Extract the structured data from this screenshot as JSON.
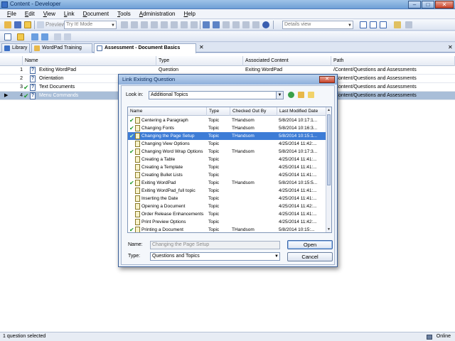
{
  "window": {
    "title": "Content - Developer",
    "min": "–",
    "max": "□",
    "close": "✕"
  },
  "menu": [
    "File",
    "Edit",
    "View",
    "Link",
    "Document",
    "Tools",
    "Administration",
    "Help"
  ],
  "toolbar": {
    "preview_label": "Preview",
    "mode_combo": "Try It! Mode",
    "view_combo": "Details view"
  },
  "tabs": [
    {
      "label": "Library"
    },
    {
      "label": "WordPad Training"
    },
    {
      "label": "Assessment - Document Basics",
      "active": true
    }
  ],
  "tab_close": "✕",
  "grid": {
    "columns": [
      "Name",
      "Type",
      "Associated Content",
      "Path"
    ],
    "rows": [
      {
        "num": "1",
        "check": "",
        "name": "Exiting WordPad",
        "type": "Question",
        "associated": "Exiting WordPad",
        "path": "/Content/Questions and Assessments"
      },
      {
        "num": "2",
        "check": "",
        "name": "Orientation",
        "type": "",
        "associated": "",
        "path": "/Content/Questions and Assessments"
      },
      {
        "num": "3",
        "check": "✔",
        "name": "Text Documents",
        "type": "",
        "associated": "",
        "path": "/Content/Questions and Assessments"
      },
      {
        "num": "4",
        "check": "✔",
        "name": "Menu Commands",
        "type": "",
        "associated": "",
        "path": "/Content/Questions and Assessments",
        "selected": true,
        "marker": "▶"
      }
    ]
  },
  "dialog": {
    "title": "Link Existing Question",
    "close": "✕",
    "look_in_label": "Look in:",
    "look_in_value": "Additional Topics",
    "columns": [
      "Name",
      "Type",
      "Checked Out By",
      "Last Modified Date"
    ],
    "items": [
      {
        "check": "✔",
        "name": "Centering a Paragraph",
        "type": "Topic",
        "checked_out": "THandsom",
        "date": "5/8/2014 10:17:1..."
      },
      {
        "check": "✔",
        "name": "Changing Fonts",
        "type": "Topic",
        "checked_out": "THandsom",
        "date": "5/8/2014 10:16:3..."
      },
      {
        "check": "✔",
        "name": "Changing the Page Setup",
        "type": "Topic",
        "checked_out": "THandsom",
        "date": "5/8/2014 10:15:1...",
        "selected": true
      },
      {
        "check": "",
        "name": "Changing View Options",
        "type": "Topic",
        "checked_out": "",
        "date": "4/25/2014 11:42:..."
      },
      {
        "check": "✔",
        "name": "Changing Word Wrap Options",
        "type": "Topic",
        "checked_out": "THandsom",
        "date": "5/8/2014 10:17:3..."
      },
      {
        "check": "",
        "name": "Creating a Table",
        "type": "Topic",
        "checked_out": "",
        "date": "4/25/2014 11:41:..."
      },
      {
        "check": "",
        "name": "Creating a Template",
        "type": "Topic",
        "checked_out": "",
        "date": "4/25/2014 11:41:..."
      },
      {
        "check": "",
        "name": "Creating Bullet Lists",
        "type": "Topic",
        "checked_out": "",
        "date": "4/25/2014 11:41:..."
      },
      {
        "check": "✔",
        "name": "Exiting WordPad",
        "type": "Topic",
        "checked_out": "THandsom",
        "date": "5/8/2014 10:15:5..."
      },
      {
        "check": "",
        "name": "Exiting WordPad_full topic",
        "type": "Topic",
        "checked_out": "",
        "date": "4/25/2014 11:41:..."
      },
      {
        "check": "",
        "name": "Inserting the Date",
        "type": "Topic",
        "checked_out": "",
        "date": "4/25/2014 11:41:..."
      },
      {
        "check": "",
        "name": "Opening a Document",
        "type": "Topic",
        "checked_out": "",
        "date": "4/25/2014 11:42:..."
      },
      {
        "check": "",
        "name": "Order Release Enhancements",
        "type": "Topic",
        "checked_out": "",
        "date": "4/25/2014 11:41:..."
      },
      {
        "check": "",
        "name": "Print Preview Options",
        "type": "Topic",
        "checked_out": "",
        "date": "4/25/2014 11:42:..."
      },
      {
        "check": "✔",
        "name": "Printing a Document",
        "type": "Topic",
        "checked_out": "THandsom",
        "date": "5/8/2014 10:15:..."
      }
    ],
    "name_label": "Name:",
    "name_value": "Changing the Page Setup",
    "type_label": "Type:",
    "type_value": "Questions and Topics",
    "open_label": "Open",
    "cancel_label": "Cancel"
  },
  "status": {
    "left": "1 question selected",
    "right": "Online"
  },
  "glyphs": {
    "question": "?",
    "dropdown": "▼",
    "up": "▲"
  }
}
